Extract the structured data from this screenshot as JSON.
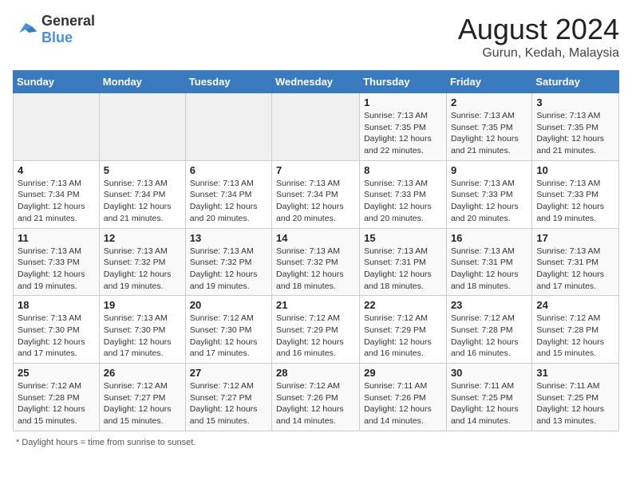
{
  "logo": {
    "text_general": "General",
    "text_blue": "Blue"
  },
  "header": {
    "month_year": "August 2024",
    "location": "Gurun, Kedah, Malaysia"
  },
  "weekdays": [
    "Sunday",
    "Monday",
    "Tuesday",
    "Wednesday",
    "Thursday",
    "Friday",
    "Saturday"
  ],
  "footer": {
    "note": "Daylight hours"
  },
  "weeks": [
    [
      {
        "day": "",
        "sunrise": "",
        "sunset": "",
        "daylight": ""
      },
      {
        "day": "",
        "sunrise": "",
        "sunset": "",
        "daylight": ""
      },
      {
        "day": "",
        "sunrise": "",
        "sunset": "",
        "daylight": ""
      },
      {
        "day": "",
        "sunrise": "",
        "sunset": "",
        "daylight": ""
      },
      {
        "day": "1",
        "sunrise": "Sunrise: 7:13 AM",
        "sunset": "Sunset: 7:35 PM",
        "daylight": "Daylight: 12 hours and 22 minutes."
      },
      {
        "day": "2",
        "sunrise": "Sunrise: 7:13 AM",
        "sunset": "Sunset: 7:35 PM",
        "daylight": "Daylight: 12 hours and 21 minutes."
      },
      {
        "day": "3",
        "sunrise": "Sunrise: 7:13 AM",
        "sunset": "Sunset: 7:35 PM",
        "daylight": "Daylight: 12 hours and 21 minutes."
      }
    ],
    [
      {
        "day": "4",
        "sunrise": "Sunrise: 7:13 AM",
        "sunset": "Sunset: 7:34 PM",
        "daylight": "Daylight: 12 hours and 21 minutes."
      },
      {
        "day": "5",
        "sunrise": "Sunrise: 7:13 AM",
        "sunset": "Sunset: 7:34 PM",
        "daylight": "Daylight: 12 hours and 21 minutes."
      },
      {
        "day": "6",
        "sunrise": "Sunrise: 7:13 AM",
        "sunset": "Sunset: 7:34 PM",
        "daylight": "Daylight: 12 hours and 20 minutes."
      },
      {
        "day": "7",
        "sunrise": "Sunrise: 7:13 AM",
        "sunset": "Sunset: 7:34 PM",
        "daylight": "Daylight: 12 hours and 20 minutes."
      },
      {
        "day": "8",
        "sunrise": "Sunrise: 7:13 AM",
        "sunset": "Sunset: 7:33 PM",
        "daylight": "Daylight: 12 hours and 20 minutes."
      },
      {
        "day": "9",
        "sunrise": "Sunrise: 7:13 AM",
        "sunset": "Sunset: 7:33 PM",
        "daylight": "Daylight: 12 hours and 20 minutes."
      },
      {
        "day": "10",
        "sunrise": "Sunrise: 7:13 AM",
        "sunset": "Sunset: 7:33 PM",
        "daylight": "Daylight: 12 hours and 19 minutes."
      }
    ],
    [
      {
        "day": "11",
        "sunrise": "Sunrise: 7:13 AM",
        "sunset": "Sunset: 7:33 PM",
        "daylight": "Daylight: 12 hours and 19 minutes."
      },
      {
        "day": "12",
        "sunrise": "Sunrise: 7:13 AM",
        "sunset": "Sunset: 7:32 PM",
        "daylight": "Daylight: 12 hours and 19 minutes."
      },
      {
        "day": "13",
        "sunrise": "Sunrise: 7:13 AM",
        "sunset": "Sunset: 7:32 PM",
        "daylight": "Daylight: 12 hours and 19 minutes."
      },
      {
        "day": "14",
        "sunrise": "Sunrise: 7:13 AM",
        "sunset": "Sunset: 7:32 PM",
        "daylight": "Daylight: 12 hours and 18 minutes."
      },
      {
        "day": "15",
        "sunrise": "Sunrise: 7:13 AM",
        "sunset": "Sunset: 7:31 PM",
        "daylight": "Daylight: 12 hours and 18 minutes."
      },
      {
        "day": "16",
        "sunrise": "Sunrise: 7:13 AM",
        "sunset": "Sunset: 7:31 PM",
        "daylight": "Daylight: 12 hours and 18 minutes."
      },
      {
        "day": "17",
        "sunrise": "Sunrise: 7:13 AM",
        "sunset": "Sunset: 7:31 PM",
        "daylight": "Daylight: 12 hours and 17 minutes."
      }
    ],
    [
      {
        "day": "18",
        "sunrise": "Sunrise: 7:13 AM",
        "sunset": "Sunset: 7:30 PM",
        "daylight": "Daylight: 12 hours and 17 minutes."
      },
      {
        "day": "19",
        "sunrise": "Sunrise: 7:13 AM",
        "sunset": "Sunset: 7:30 PM",
        "daylight": "Daylight: 12 hours and 17 minutes."
      },
      {
        "day": "20",
        "sunrise": "Sunrise: 7:12 AM",
        "sunset": "Sunset: 7:30 PM",
        "daylight": "Daylight: 12 hours and 17 minutes."
      },
      {
        "day": "21",
        "sunrise": "Sunrise: 7:12 AM",
        "sunset": "Sunset: 7:29 PM",
        "daylight": "Daylight: 12 hours and 16 minutes."
      },
      {
        "day": "22",
        "sunrise": "Sunrise: 7:12 AM",
        "sunset": "Sunset: 7:29 PM",
        "daylight": "Daylight: 12 hours and 16 minutes."
      },
      {
        "day": "23",
        "sunrise": "Sunrise: 7:12 AM",
        "sunset": "Sunset: 7:28 PM",
        "daylight": "Daylight: 12 hours and 16 minutes."
      },
      {
        "day": "24",
        "sunrise": "Sunrise: 7:12 AM",
        "sunset": "Sunset: 7:28 PM",
        "daylight": "Daylight: 12 hours and 15 minutes."
      }
    ],
    [
      {
        "day": "25",
        "sunrise": "Sunrise: 7:12 AM",
        "sunset": "Sunset: 7:28 PM",
        "daylight": "Daylight: 12 hours and 15 minutes."
      },
      {
        "day": "26",
        "sunrise": "Sunrise: 7:12 AM",
        "sunset": "Sunset: 7:27 PM",
        "daylight": "Daylight: 12 hours and 15 minutes."
      },
      {
        "day": "27",
        "sunrise": "Sunrise: 7:12 AM",
        "sunset": "Sunset: 7:27 PM",
        "daylight": "Daylight: 12 hours and 15 minutes."
      },
      {
        "day": "28",
        "sunrise": "Sunrise: 7:12 AM",
        "sunset": "Sunset: 7:26 PM",
        "daylight": "Daylight: 12 hours and 14 minutes."
      },
      {
        "day": "29",
        "sunrise": "Sunrise: 7:11 AM",
        "sunset": "Sunset: 7:26 PM",
        "daylight": "Daylight: 12 hours and 14 minutes."
      },
      {
        "day": "30",
        "sunrise": "Sunrise: 7:11 AM",
        "sunset": "Sunset: 7:25 PM",
        "daylight": "Daylight: 12 hours and 14 minutes."
      },
      {
        "day": "31",
        "sunrise": "Sunrise: 7:11 AM",
        "sunset": "Sunset: 7:25 PM",
        "daylight": "Daylight: 12 hours and 13 minutes."
      }
    ]
  ]
}
